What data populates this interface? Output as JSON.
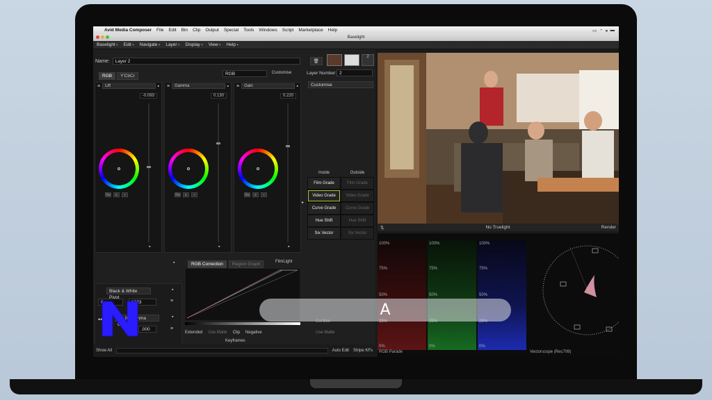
{
  "mac_menu": {
    "app": "Avid Media Composer",
    "items": [
      "File",
      "Edit",
      "Bin",
      "Clip",
      "Output",
      "Special",
      "Tools",
      "Windows",
      "Script",
      "Marketplace",
      "Help"
    ]
  },
  "window_title": "Baselight",
  "app_menu": [
    "Baselight",
    "Edit",
    "Navigate",
    "Layer",
    "Display",
    "View",
    "Help"
  ],
  "layer": {
    "name_label": "Name:",
    "name_value": "Layer 2",
    "number_label": "Layer Number:",
    "number_value": "2",
    "thumb_count": "2"
  },
  "color_tabs": [
    "RGB",
    "Y'CbCr"
  ],
  "color_space": "RGB",
  "customise_label": "Customise",
  "customise_dropdown": "Customise",
  "wheels": [
    {
      "name": "Lift",
      "value": "-0.093",
      "level": 0.55
    },
    {
      "name": "Gamma",
      "value": "0.130",
      "level": 0.72
    },
    {
      "name": "Gain",
      "value": "0.220",
      "level": 0.7
    }
  ],
  "grade_table": {
    "inside_header": "Inside",
    "outside_header": "Outside",
    "rows": [
      {
        "in": "Film Grade",
        "out": "Film Grade",
        "selected": false
      },
      {
        "in": "Video Grade",
        "out": "Video Grade",
        "selected": true
      },
      {
        "in": "Curve Grade",
        "out": "Curve Grade",
        "selected": false
      },
      {
        "in": "Hue Shift",
        "out": "Hue Shift",
        "selected": false
      },
      {
        "in": "Six Vector",
        "out": "Six Vector",
        "selected": false
      }
    ]
  },
  "pivot": {
    "label": "Black & White Pivot",
    "low": "0",
    "high": "1023",
    "gamma_label": "Y' Lift Gamma Gain",
    "gamma_value": ".000"
  },
  "curve_tabs": [
    "RGB Correction",
    "Region Graph"
  ],
  "filmlight_label": "FilmLight",
  "curve_options": {
    "extended": "Extended",
    "use_matte": "Use Matte",
    "clip": "Clip",
    "negative": "Negative",
    "keyframes": "Keyframes",
    "col_blur": "Col Blur",
    "use_matte2": "Use Matte"
  },
  "bottom_bar": {
    "show_all": "Show All",
    "auto_edit": "Auto Edit",
    "stripe_kfs": "Stripe KFs"
  },
  "viewer": {
    "truelight": "No Truelight",
    "render": "Render"
  },
  "scopes": {
    "parade_label": "RGB Parade",
    "vectorscope_label": "Vectorscope (Rec709)",
    "marks": [
      "100%",
      "75%",
      "50%",
      "25%",
      "0%"
    ]
  },
  "overlay_letter": "A",
  "colors": {
    "accent_select": "#b9c230",
    "logo": "#2b1bff"
  }
}
